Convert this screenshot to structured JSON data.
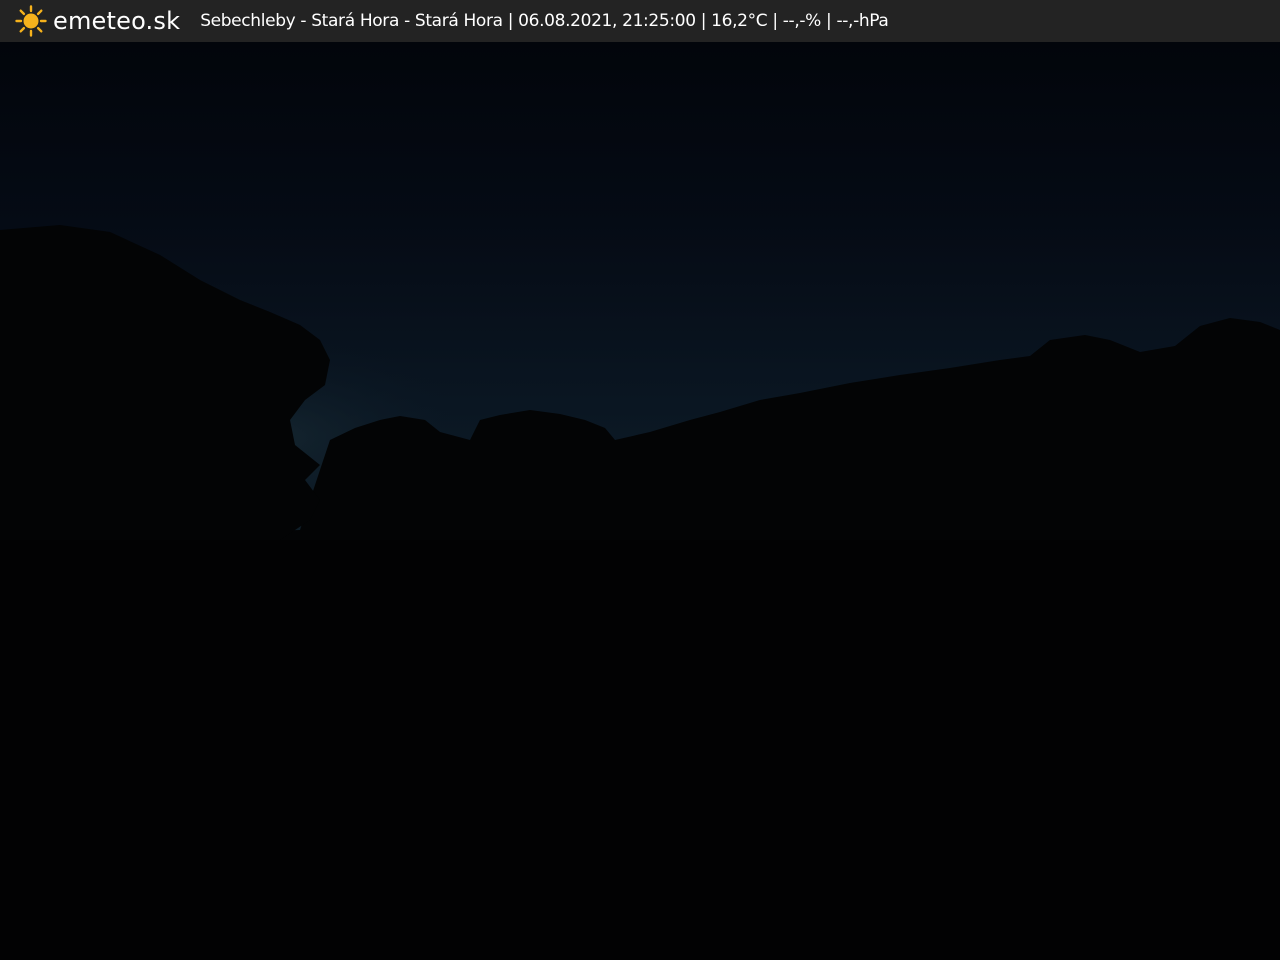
{
  "header": {
    "brand": "emeteo.sk",
    "brand_icon": "sun-icon",
    "caption": "Sebechleby - Stará Hora - Stará Hora | 06.08.2021, 21:25:00 | 16,2°C | --,-% | --,-hPa"
  },
  "colors": {
    "header_background": "#232323",
    "sun": "#f6b21c",
    "sky_top": "#02050b",
    "sky_horizon": "#0d1c28",
    "ground": "#020203"
  }
}
